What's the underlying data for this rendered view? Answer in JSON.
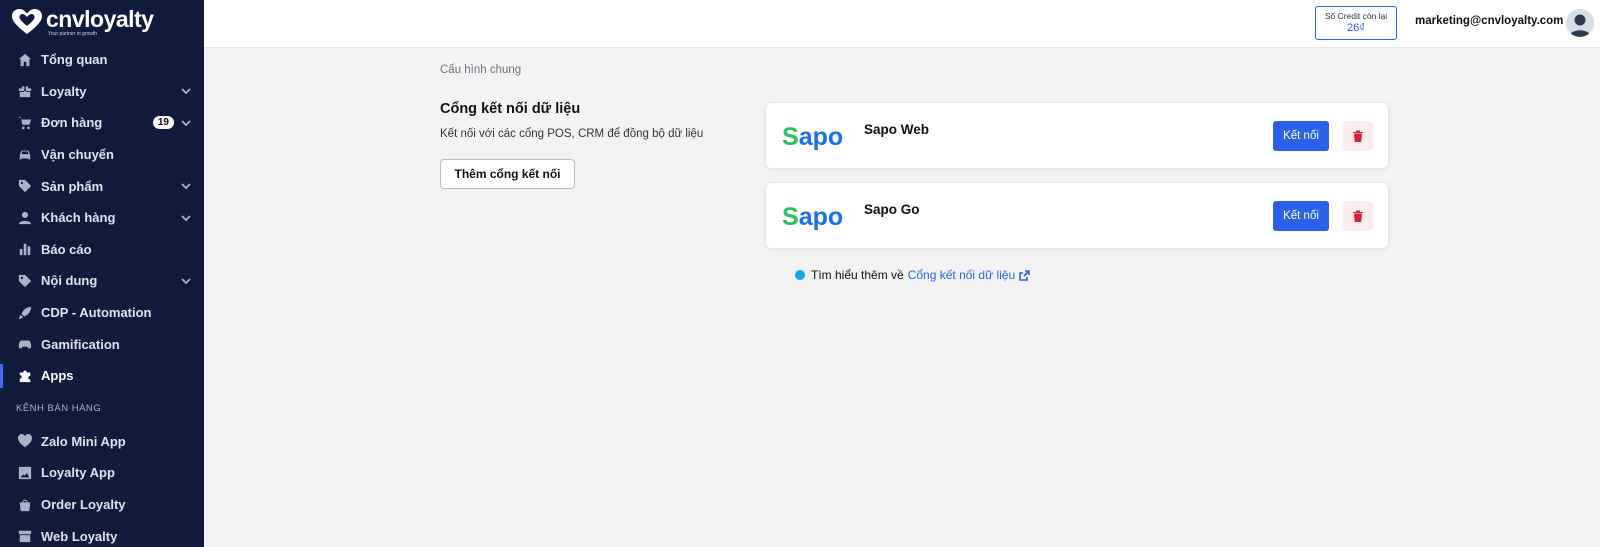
{
  "brand": {
    "name": "cnvloyalty",
    "tagline": "Your partner in growth"
  },
  "sidebar": {
    "items": [
      {
        "label": "Tổng quan",
        "icon": "home-icon",
        "expandable": false
      },
      {
        "label": "Loyalty",
        "icon": "gift-icon",
        "expandable": true
      },
      {
        "label": "Đơn hàng",
        "icon": "cart-icon",
        "expandable": true,
        "badge": "19"
      },
      {
        "label": "Vận chuyển",
        "icon": "car-icon",
        "expandable": false
      },
      {
        "label": "Sản phẩm",
        "icon": "tag-icon",
        "expandable": true
      },
      {
        "label": "Khách hàng",
        "icon": "user-icon",
        "expandable": true
      },
      {
        "label": "Báo cáo",
        "icon": "bar-chart-icon",
        "expandable": false
      },
      {
        "label": "Nội dung",
        "icon": "tag-icon",
        "expandable": true
      },
      {
        "label": "CDP - Automation",
        "icon": "rocket-icon",
        "expandable": false
      },
      {
        "label": "Gamification",
        "icon": "gamepad-icon",
        "expandable": false
      },
      {
        "label": "Apps",
        "icon": "puzzle-icon",
        "expandable": false,
        "active": true
      }
    ],
    "sales_channel_label": "KÊNH BÁN HÀNG",
    "channel_items": [
      {
        "label": "Zalo Mini App",
        "icon": "heart-icon"
      },
      {
        "label": "Loyalty App",
        "icon": "image-icon"
      },
      {
        "label": "Order Loyalty",
        "icon": "bag-icon"
      },
      {
        "label": "Web Loyalty",
        "icon": "store-icon"
      }
    ]
  },
  "header": {
    "credit_label": "Số Credit còn lại",
    "credit_value": "26₫",
    "user_email": "marketing@cnvloyalty.com"
  },
  "main": {
    "breadcrumb": "Cấu hình chung",
    "section_title": "Cổng kết nối dữ liệu",
    "section_desc": "Kết nối với các cổng POS, CRM để đồng bộ dữ liệu",
    "add_button": "Thêm cổng kết nối",
    "connectors": [
      {
        "name": "Sapo Web",
        "logo": "Sapo",
        "connect_label": "Kết nối"
      },
      {
        "name": "Sapo Go",
        "logo": "Sapo",
        "connect_label": "Kết nối"
      }
    ],
    "learn_more_text": "Tìm hiểu thêm về",
    "learn_more_link": "Cổng kết nối dữ liệu"
  },
  "colors": {
    "sidebar_bg": "#101a3c",
    "accent": "#2b62e8",
    "sapo_green": "#22c55e",
    "sapo_blue": "#1d6ff2",
    "delete": "#d02640"
  }
}
